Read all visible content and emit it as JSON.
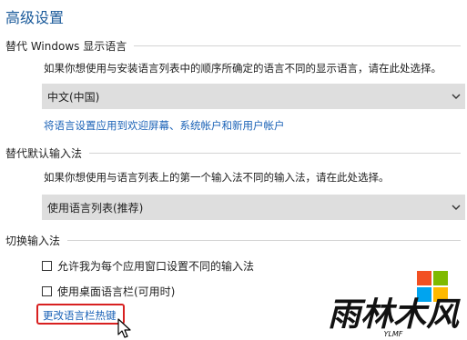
{
  "page_title": "高级设置",
  "display_lang": {
    "heading": "替代 Windows 显示语言",
    "description": "如果你想使用与安装语言列表中的顺序所确定的语言不同的显示语言，请在此处选择。",
    "selected": "中文(中国)",
    "link": "将语言设置应用到欢迎屏幕、系统帐户和新用户帐户"
  },
  "input_method": {
    "heading": "替代默认输入法",
    "description": "如果你想使用与语言列表上的第一个输入法不同的输入法，请在此处选择。",
    "selected": "使用语言列表(推荐)"
  },
  "switch_input": {
    "heading": "切换输入法",
    "option1": "允许我为每个应用窗口设置不同的输入法",
    "option1_checked": false,
    "option2": "使用桌面语言栏(可用时)",
    "option2_checked": false,
    "hotkey_link": "更改语言栏热键"
  },
  "watermark": {
    "brand": "雨林木风",
    "brand_sub": "YLMF",
    "colors": [
      "#f25022",
      "#7fba00",
      "#00a4ef",
      "#ffb900"
    ]
  }
}
